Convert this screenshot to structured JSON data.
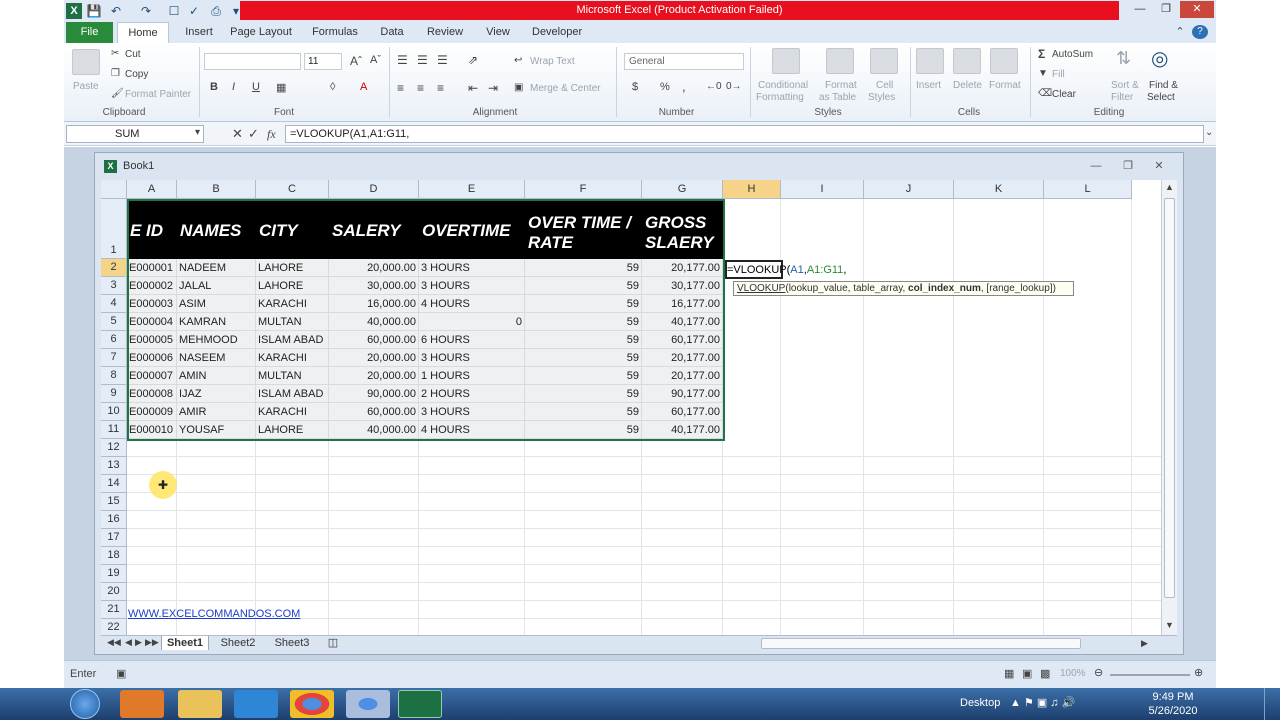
{
  "window": {
    "title": "Microsoft Excel (Product Activation Failed)"
  },
  "tabs": [
    "File",
    "Home",
    "Insert",
    "Page Layout",
    "Formulas",
    "Data",
    "Review",
    "View",
    "Developer"
  ],
  "ribbon": {
    "clipboard": {
      "paste": "Paste",
      "cut": "Cut",
      "copy": "Copy",
      "format_painter": "Format Painter",
      "label": "Clipboard"
    },
    "font": {
      "size": "11",
      "bold": "B",
      "italic": "I",
      "underline": "U",
      "label": "Font"
    },
    "alignment": {
      "wrap_text": "Wrap Text",
      "merge_center": "Merge & Center",
      "label": "Alignment"
    },
    "number": {
      "format": "General",
      "currency": "$",
      "percent": "%",
      "comma": ",",
      "label": "Number"
    },
    "styles": {
      "conditional": "Conditional",
      "formatting": "Formatting",
      "format_as": "Format",
      "as_table": "as Table",
      "cell": "Cell",
      "styles_word": "Styles",
      "label": "Styles"
    },
    "cells": {
      "insert": "Insert",
      "delete": "Delete",
      "format": "Format",
      "label": "Cells"
    },
    "editing": {
      "autosum": "AutoSum",
      "fill": "Fill",
      "clear": "Clear",
      "sort": "Sort &",
      "filter": "Filter",
      "find": "Find &",
      "select": "Select",
      "label": "Editing"
    }
  },
  "formula_bar": {
    "name_box": "SUM",
    "fx": "fx",
    "formula": "=VLOOKUP(A1,A1:G11,"
  },
  "book": {
    "title": "Book1"
  },
  "columns": [
    "A",
    "B",
    "C",
    "D",
    "E",
    "F",
    "G",
    "H",
    "I",
    "J",
    "K",
    "L"
  ],
  "rows": [
    "1",
    "2",
    "3",
    "4",
    "5",
    "6",
    "7",
    "8",
    "9",
    "10",
    "11",
    "12",
    "13",
    "14",
    "15",
    "16",
    "17",
    "18",
    "19",
    "20",
    "21",
    "22"
  ],
  "table": {
    "headers": [
      "E ID",
      "NAMES",
      "CITY",
      "SALERY",
      "OVERTIME",
      "OVER TIME / RATE",
      "GROSS SLAERY"
    ],
    "rows": [
      [
        "E000001",
        "NADEEM",
        "LAHORE",
        "20,000.00",
        "3 HOURS",
        "59",
        "20,177.00"
      ],
      [
        "E000002",
        "JALAL",
        "LAHORE",
        "30,000.00",
        "3 HOURS",
        "59",
        "30,177.00"
      ],
      [
        "E000003",
        "ASIM",
        "KARACHI",
        "16,000.00",
        "4 HOURS",
        "59",
        "16,177.00"
      ],
      [
        "E000004",
        "KAMRAN",
        "MULTAN",
        "40,000.00",
        "0",
        "59",
        "40,177.00"
      ],
      [
        "E000005",
        "MEHMOOD",
        "ISLAM ABAD",
        "60,000.00",
        "6 HOURS",
        "59",
        "60,177.00"
      ],
      [
        "E000006",
        "NASEEM",
        "KARACHI",
        "20,000.00",
        "3 HOURS",
        "59",
        "20,177.00"
      ],
      [
        "E000007",
        "AMIN",
        "MULTAN",
        "20,000.00",
        "1 HOURS",
        "59",
        "20,177.00"
      ],
      [
        "E000008",
        "IJAZ",
        "ISLAM ABAD",
        "90,000.00",
        "2 HOURS",
        "59",
        "90,177.00"
      ],
      [
        "E000009",
        "AMIR",
        "KARACHI",
        "60,000.00",
        "3 HOURS",
        "59",
        "60,177.00"
      ],
      [
        "E000010",
        "YOUSAF",
        "LAHORE",
        "40,000.00",
        "4 HOURS",
        "59",
        "40,177.00"
      ]
    ]
  },
  "edit": {
    "prefix": "=VLOOKUP(",
    "ref1": "A1",
    "comma1": ",",
    "ref2": "A1:G11",
    "comma2": ","
  },
  "tooltip": {
    "fn": "VLOOKUP",
    "open": "(",
    "a1": "lookup_value, ",
    "a2": "table_array, ",
    "a3": "col_index_num",
    "a4": ", [range_lookup])"
  },
  "link": "WWW.EXCELCOMMANDOS.COM",
  "sheets": [
    "Sheet1",
    "Sheet2",
    "Sheet3"
  ],
  "status": {
    "mode": "Enter",
    "zoom": "100%"
  },
  "taskbar": {
    "desktop": "Desktop",
    "time": "9:49 PM",
    "date": "5/26/2020"
  },
  "colors": {
    "title_red": "#e8101e",
    "file_green": "#2a8a3b",
    "selection_green": "#217346",
    "header_black": "#000000"
  }
}
